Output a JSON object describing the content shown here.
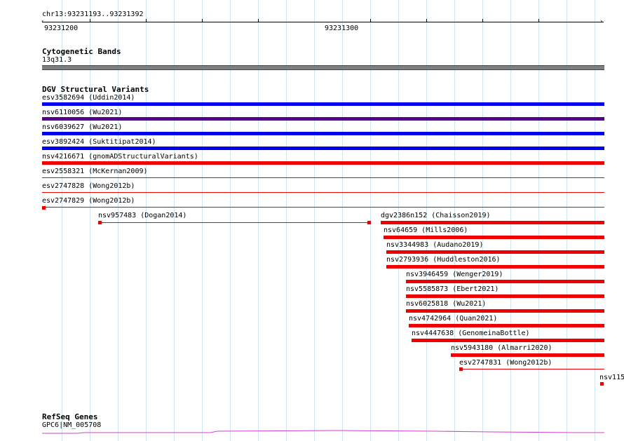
{
  "ruler": {
    "location": "chr13:93231193..93231392",
    "tick_labels": [
      "93231200",
      "93231300"
    ]
  },
  "cytobands": {
    "title": "Cytogenetic Bands",
    "band": "13q31.3",
    "color": "#7f7f7f"
  },
  "dgv": {
    "title": "DGV Structural Variants",
    "features": [
      {
        "label": "esv3582694 (Uddin2014)",
        "color": "#0000ee"
      },
      {
        "label": "nsv6110056 (Wu2021)",
        "color": "#55008a"
      },
      {
        "label": "nsv6039627 (Wu2021)",
        "color": "#0000ee"
      },
      {
        "label": "esv3892424 (Suktitipat2014)",
        "color": "#0000ee"
      },
      {
        "label": "nsv4216671 (gnomADStructuralVariants)",
        "color": "#ee0000"
      },
      {
        "label": "esv2558321 (McKernan2009)",
        "color": "#ee0000"
      },
      {
        "label": "esv2747828 (Wong2012b)",
        "color": "#ee0000"
      },
      {
        "label": "esv2747829 (Wong2012b)",
        "color": "#ee0000"
      },
      {
        "label": "nsv957483 (Dogan2014)",
        "color": "#ee0000"
      },
      {
        "label": "dgv2386n152 (Chaisson2019)",
        "color": "#ee0000"
      },
      {
        "label": "nsv64659 (Mills2006)",
        "color": "#ee0000"
      },
      {
        "label": "nsv3344983 (Audano2019)",
        "color": "#ee0000"
      },
      {
        "label": "nsv2793936 (Huddleston2016)",
        "color": "#ee0000"
      },
      {
        "label": "nsv3946459 (Wenger2019)",
        "color": "#ee0000"
      },
      {
        "label": "nsv5585873 (Ebert2021)",
        "color": "#ee0000"
      },
      {
        "label": "nsv6025818 (Wu2021)",
        "color": "#ee0000"
      },
      {
        "label": "nsv4742964 (Quan2021)",
        "color": "#ee0000"
      },
      {
        "label": "nsv4447638 (GenomeinaBottle)",
        "color": "#ee0000"
      },
      {
        "label": "nsv5943180 (Almarri2020)",
        "color": "#ee0000"
      },
      {
        "label": "esv2747831 (Wong2012b)",
        "color": "#ee0000"
      },
      {
        "label": "nsv115",
        "color": "#ee0000"
      }
    ]
  },
  "refseq": {
    "title": "RefSeq Genes",
    "gene": "GPC6|NM_005708",
    "color": "#cc44cc"
  }
}
